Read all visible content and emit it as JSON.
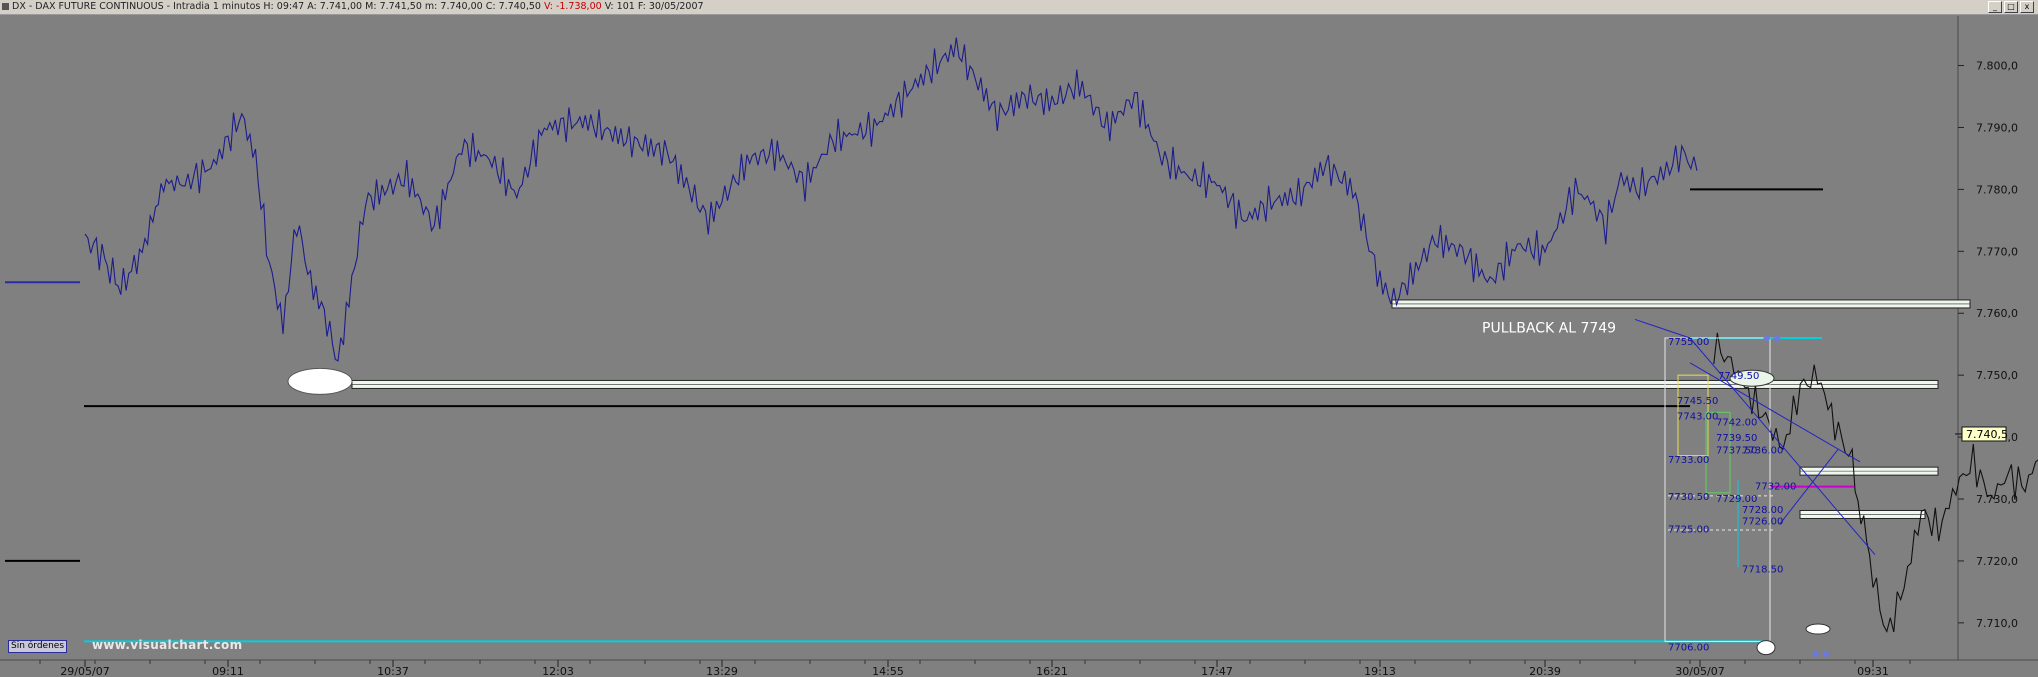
{
  "titlebar": {
    "symbol": "DX - DAX FUTURE CONTINUOUS - Intradia 1 minutos",
    "h_label": "H:",
    "h_value": "09:47",
    "a_label": "A:",
    "a_value": "7.741,00",
    "m_label": "M:",
    "m_value": "7.741,50",
    "mn_label": "m:",
    "mn_value": "7.740,00",
    "c_label": "C:",
    "c_value": "7.740,50",
    "var_label": "V:",
    "var_value": "-1.738,00",
    "v_label": "V:",
    "v_value": "101",
    "f_label": "F:",
    "f_value": "30/05/2007",
    "buttons": [
      "_",
      "□",
      "x"
    ]
  },
  "footer": {
    "orders_badge": "Sin órdenes",
    "watermark": "www.visualchart.com"
  },
  "chart_data": {
    "type": "line",
    "instrument": "DX - DAX FUTURE CONTINUOUS",
    "interval": "Intradia 1 minutos",
    "y_axis": {
      "ylim": [
        7704,
        7808
      ],
      "ticks": [
        "7.710,0",
        "7.720,0",
        "7.730,0",
        "7.740,0",
        "7.750,0",
        "7.760,0",
        "7.770,0",
        "7.780,0",
        "7.790,0",
        "7.800,0"
      ],
      "tick_values": [
        7710,
        7720,
        7730,
        7740,
        7750,
        7760,
        7770,
        7780,
        7790,
        7800
      ],
      "last_price_label": "7.740,5",
      "last_price": 7740.5
    },
    "x_axis": {
      "ticks": [
        "29/05/07",
        "09:11",
        "10:37",
        "12:03",
        "13:29",
        "14:55",
        "16:21",
        "17:47",
        "19:13",
        "20:39",
        "30/05/07",
        "09:31"
      ],
      "tick_index": [
        0,
        100,
        220,
        340,
        460,
        580,
        700,
        820,
        940,
        1060,
        1162,
        1262
      ]
    },
    "series": [
      {
        "color": "#1c1c8c",
        "index": [
          0,
          10,
          25,
          40,
          55,
          70,
          90,
          110,
          120,
          130,
          140,
          150,
          160,
          170,
          180,
          200,
          230,
          250,
          270,
          290,
          310,
          330,
          360,
          390,
          420,
          450,
          480,
          500,
          520,
          540,
          570,
          600,
          630,
          660,
          680,
          700,
          720,
          740,
          760,
          780,
          800,
          820,
          840,
          860,
          880,
          900,
          920,
          940,
          950,
          960,
          980,
          1000,
          1020,
          1040,
          1060,
          1080,
          1090,
          1100,
          1110,
          1120,
          1140,
          1150,
          1160
        ],
        "values": [
          7772,
          7770,
          7764,
          7770,
          7781,
          7781,
          7784,
          7792,
          7785,
          7768,
          7758,
          7775,
          7765,
          7760,
          7752,
          7778,
          7782,
          7774,
          7787,
          7785,
          7779,
          7790,
          7791,
          7788,
          7786,
          7775,
          7785,
          7786,
          7781,
          7788,
          7790,
          7797,
          7803,
          7792,
          7795,
          7794,
          7797,
          7790,
          7795,
          7785,
          7782,
          7781,
          7775,
          7778,
          7779,
          7784,
          7780,
          7765,
          7762,
          7765,
          7772,
          7770,
          7765,
          7771,
          7770,
          7780,
          7778,
          7774,
          7782,
          7780,
          7783,
          7786,
          7783
        ]
      },
      {
        "color": "#101010",
        "index": [
          1170,
          1180,
          1190,
          1200,
          1210,
          1220,
          1230,
          1240,
          1250,
          1255,
          1260,
          1270,
          1280,
          1290,
          1300,
          1310,
          1320,
          1330,
          1340,
          1350,
          1360,
          1370,
          1380,
          1390,
          1400,
          1410
        ],
        "values": [
          7755,
          7752,
          7747,
          7743,
          7738,
          7748,
          7750,
          7742,
          7736,
          7728,
          7720,
          7708,
          7716,
          7728,
          7725,
          7732,
          7736,
          7730,
          7734,
          7732,
          7738,
          7736,
          7738,
          7739,
          7741,
          7740.5
        ]
      }
    ],
    "levels": [
      {
        "value": 7765,
        "color": "#2a2aaa"
      },
      {
        "value": 7780,
        "color": "#000000"
      },
      {
        "value": 7761.5,
        "color": "#ffffff",
        "label_box": true
      },
      {
        "value": 7748.5,
        "color": "#ffffff",
        "label_box": true
      },
      {
        "value": 7745,
        "color": "#000000"
      },
      {
        "value": 7720,
        "color": "#000000"
      },
      {
        "value": 7707,
        "color": "#00d0e0"
      },
      {
        "value": 7756,
        "color": "#00d0e0"
      },
      {
        "value": 7734.5,
        "color": "#ffffff",
        "label_box": true
      },
      {
        "value": 7727.5,
        "color": "#ffffff",
        "label_box": true
      },
      {
        "value": 7732,
        "color": "#cc00cc"
      }
    ],
    "annotations": [
      {
        "text": "PULLBACK AL 7749",
        "color": "#ffffff"
      },
      {
        "text": "7755.00",
        "color": "#1010a0"
      },
      {
        "text": "7749.50",
        "color": "#1010a0"
      },
      {
        "text": "7745.50",
        "color": "#1010a0"
      },
      {
        "text": "7743.00",
        "color": "#1010a0"
      },
      {
        "text": "7742.00",
        "color": "#1010a0"
      },
      {
        "text": "7739.50",
        "color": "#1010a0"
      },
      {
        "text": "7737.50",
        "color": "#1010a0"
      },
      {
        "text": "7736.00",
        "color": "#1010a0"
      },
      {
        "text": "7733.00",
        "color": "#1010a0"
      },
      {
        "text": "7730.50",
        "color": "#1010a0"
      },
      {
        "text": "7732.00",
        "color": "#1010a0"
      },
      {
        "text": "7729.00",
        "color": "#1010a0"
      },
      {
        "text": "7728.00",
        "color": "#1010a0"
      },
      {
        "text": "7726.00",
        "color": "#1010a0"
      },
      {
        "text": "7725.00",
        "color": "#1010a0"
      },
      {
        "text": "7718.50",
        "color": "#1010a0"
      },
      {
        "text": "7706.00",
        "color": "#1010a0"
      }
    ]
  }
}
